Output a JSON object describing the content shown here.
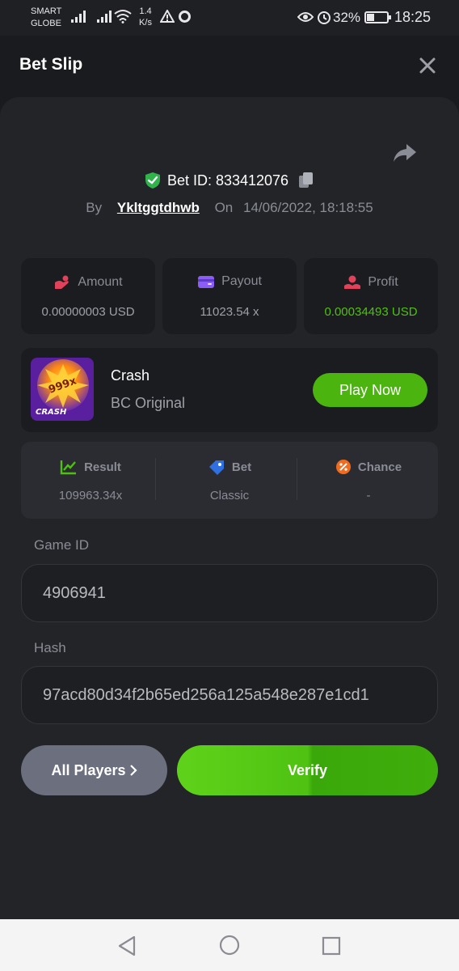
{
  "status_bar": {
    "carrier_line1": "SMART",
    "carrier_line2": "GLOBE",
    "speed_value": "1.4",
    "speed_unit": "K/s",
    "battery_percent": "32%",
    "time": "18:25"
  },
  "header": {
    "title": "Bet Slip"
  },
  "bet": {
    "id_label": "Bet ID: 833412076",
    "by_label": "By",
    "username": "Ykltggtdhwb",
    "on_label": "On",
    "datetime": "14/06/2022, 18:18:55"
  },
  "stats": {
    "amount": {
      "label": "Amount",
      "value": "0.00000003 USD"
    },
    "payout": {
      "label": "Payout",
      "value": "11023.54 x"
    },
    "profit": {
      "label": "Profit",
      "value": "0.00034493 USD"
    }
  },
  "game": {
    "name": "Crash",
    "subtitle": "BC Original",
    "play_label": "Play Now",
    "thumb_text_top": "999x",
    "thumb_text_bottom": "CRASH"
  },
  "details": {
    "result": {
      "label": "Result",
      "value": "109963.34x"
    },
    "bet": {
      "label": "Bet",
      "value": "Classic"
    },
    "chance": {
      "label": "Chance",
      "value": "-"
    }
  },
  "fields": {
    "game_id_label": "Game ID",
    "game_id_value": "4906941",
    "hash_label": "Hash",
    "hash_value": "97acd80d34f2b65ed256a125a548e287e1cd1"
  },
  "actions": {
    "all_players_label": "All Players",
    "verify_label": "Verify"
  },
  "colors": {
    "accent_green": "#4bb40e",
    "profit_green": "#4ec10e",
    "background": "#1a1b1f",
    "panel": "#232428"
  }
}
